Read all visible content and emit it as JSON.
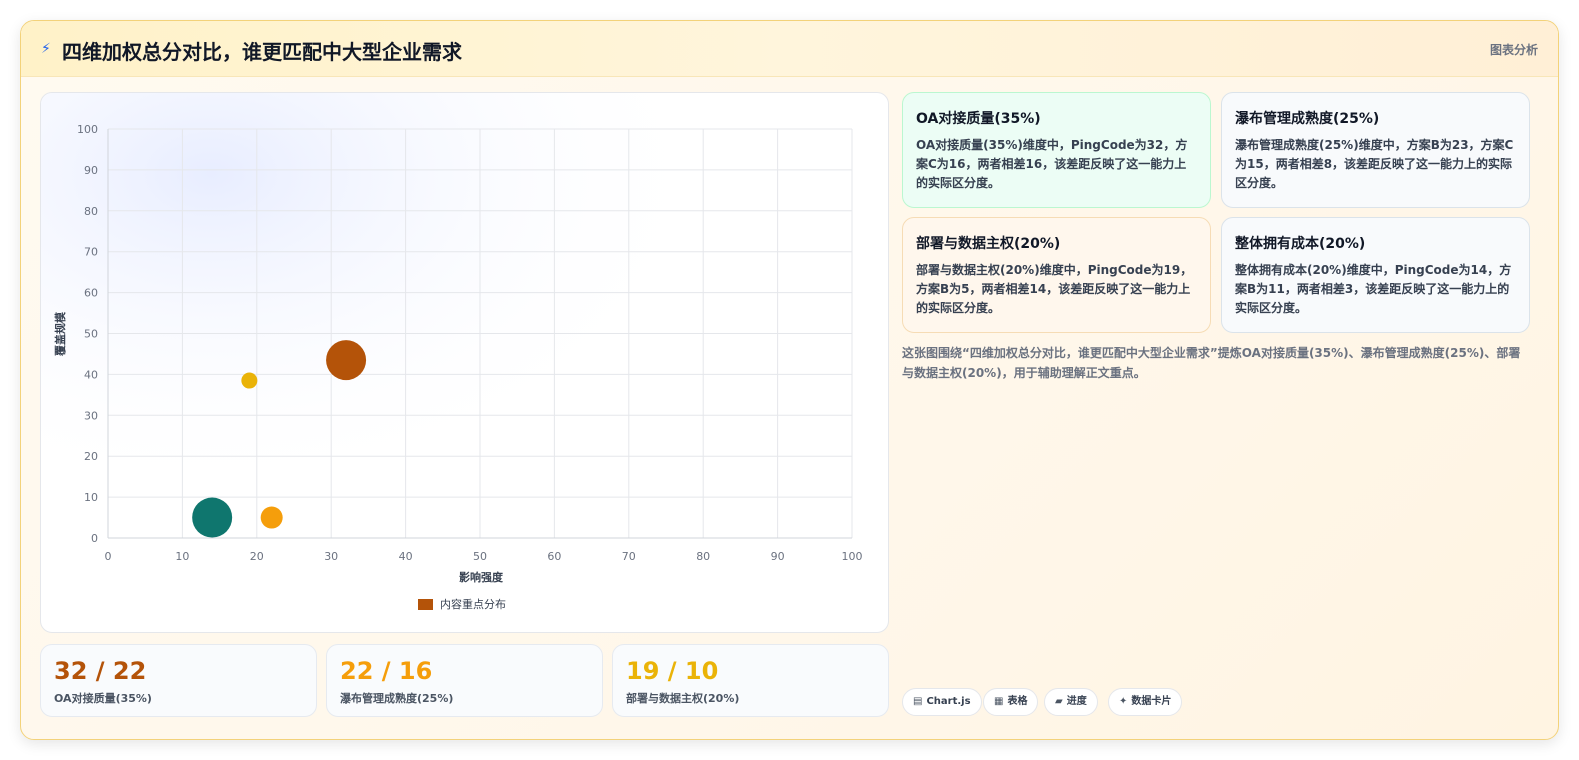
{
  "header": {
    "icon": "lightning-icon",
    "title": "四维加权总分对比，谁更匹配中大型企业需求",
    "tag": "图表分析"
  },
  "chart_data": {
    "type": "scatter",
    "xlabel": "影响强度",
    "ylabel": "覆盖规模",
    "xlim": [
      0,
      100
    ],
    "ylim": [
      0,
      100
    ],
    "xticks": [
      0,
      10,
      20,
      30,
      40,
      50,
      60,
      70,
      80,
      90,
      100
    ],
    "yticks": [
      0,
      10,
      20,
      30,
      40,
      50,
      60,
      70,
      80,
      90,
      100
    ],
    "grid": true,
    "legend_position": "bottom",
    "series": [
      {
        "name": "内容重点分布",
        "points": [
          {
            "x": 32,
            "y": 43.5,
            "r": 20,
            "color": "#b45309"
          },
          {
            "x": 14,
            "y": 5,
            "r": 20,
            "color": "#0f766e"
          },
          {
            "x": 22,
            "y": 5,
            "r": 11,
            "color": "#f59e0b"
          },
          {
            "x": 19,
            "y": 38.5,
            "r": 8,
            "color": "#eab308"
          }
        ]
      }
    ]
  },
  "metrics": [
    {
      "value": "32 / 22",
      "label": "OA对接质量(35%)",
      "color": "#b45309"
    },
    {
      "value": "22 / 16",
      "label": "瀑布管理成熟度(25%)",
      "color": "#f59e0b"
    },
    {
      "value": "19 / 10",
      "label": "部署与数据主权(20%)",
      "color": "#eab308"
    }
  ],
  "cards": [
    {
      "title": "OA对接质量(35%)",
      "desc": "OA对接质量(35%)维度中，PingCode为32，方案C为16，两者相差16，该差距反映了这一能力上的实际区分度。",
      "bg": "#ecfdf5",
      "border": "#bbf7d0"
    },
    {
      "title": "瀑布管理成熟度(25%)",
      "desc": "瀑布管理成熟度(25%)维度中，方案B为23，方案C为15，两者相差8，该差距反映了这一能力上的实际区分度。",
      "bg": "#f8fafc",
      "border": "#dbe3ea"
    },
    {
      "title": "部署与数据主权(20%)",
      "desc": "部署与数据主权(20%)维度中，PingCode为19，方案B为5，两者相差14，该差距反映了这一能力上的实际区分度。",
      "bg": "#fff7ed",
      "border": "#f6dcb5"
    },
    {
      "title": "整体拥有成本(20%)",
      "desc": "整体拥有成本(20%)维度中，PingCode为14，方案B为11，两者相差3，该差距反映了这一能力上的实际区分度。",
      "bg": "#f8fafc",
      "border": "#dbe3ea"
    }
  ],
  "summary": "这张图围绕“四维加权总分对比，谁更匹配中大型企业需求”提炼OA对接质量(35%)、瀑布管理成熟度(25%)、部署与数据主权(20%)，用于辅助理解正文重点。",
  "chips": [
    {
      "icon": "chart-icon",
      "glyph": "▤",
      "label": "Chart.js"
    },
    {
      "icon": "table-icon",
      "glyph": "▦",
      "label": "表格"
    },
    {
      "icon": "progress-icon",
      "glyph": "▰",
      "label": "进度"
    },
    {
      "icon": "sparkle-icon",
      "glyph": "✦",
      "label": "数据卡片"
    }
  ]
}
